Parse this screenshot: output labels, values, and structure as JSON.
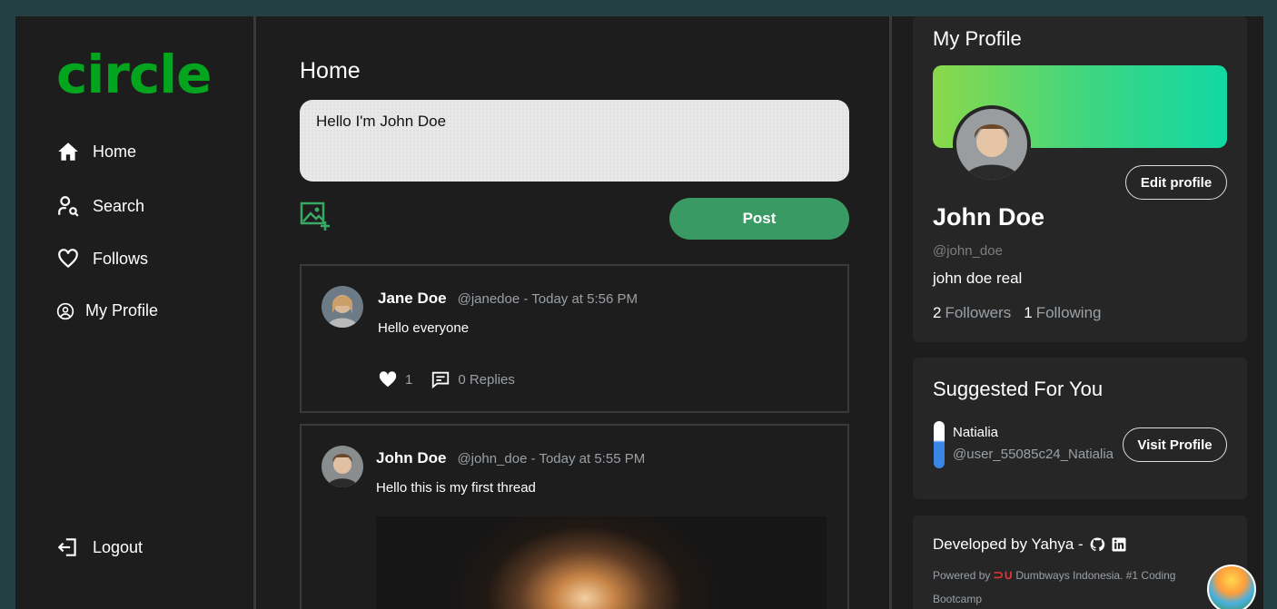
{
  "app": {
    "logo": "circle"
  },
  "nav": {
    "home": "Home",
    "search": "Search",
    "follows": "Follows",
    "profile": "My Profile",
    "logout": "Logout"
  },
  "main": {
    "title": "Home",
    "composer_text": "Hello I'm John Doe",
    "post_label": "Post"
  },
  "threads": [
    {
      "name": "Jane Doe",
      "meta": "@janedoe - Today at 5:56 PM",
      "body": "Hello everyone",
      "likes": "1",
      "replies": "0 Replies"
    },
    {
      "name": "John Doe",
      "meta": "@john_doe - Today at 5:55 PM",
      "body": "Hello this is my first thread"
    }
  ],
  "profile": {
    "title": "My Profile",
    "edit_label": "Edit profile",
    "name": "John Doe",
    "handle": "@john_doe",
    "bio": "john doe real",
    "followers_count": "2",
    "followers_label": "Followers",
    "following_count": "1",
    "following_label": "Following"
  },
  "suggested": {
    "title": "Suggested For You",
    "name": "Natialia",
    "handle": "@user_55085c24_Natialia",
    "visit_label": "Visit Profile"
  },
  "footer": {
    "developed": "Developed by Yahya -",
    "powered_prefix": "Powered by",
    "powered_suffix": "Dumbways Indonesia. #1 Coding Bootcamp"
  },
  "colors": {
    "accent": "#04a51e",
    "post_button": "#3a9a63",
    "background": "#1d1d1d"
  }
}
